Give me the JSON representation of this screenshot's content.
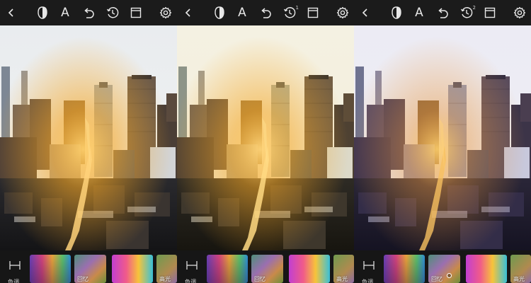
{
  "toolbar": {
    "back_icon": "chevron-left-icon",
    "mask_icon": "half-mask-icon",
    "text_tool_label": "A",
    "undo_icon": "undo-icon",
    "history_icon": "history-icon",
    "crop_icon": "frame-icon",
    "settings_icon": "gear-icon"
  },
  "panels": [
    {
      "variant": "original",
      "history_badge": "",
      "filters": [
        {
          "name": "色调"
        },
        {
          "name": "",
          "selected": false
        },
        {
          "name": "回忆",
          "selected": false
        },
        {
          "name": "",
          "selected": false
        },
        {
          "name": "高光",
          "selected": false
        }
      ]
    },
    {
      "variant": "warm-faded",
      "history_badge": "1",
      "filters": [
        {
          "name": "色调"
        },
        {
          "name": "",
          "selected": false
        },
        {
          "name": "回忆",
          "selected": false
        },
        {
          "name": "",
          "selected": false
        },
        {
          "name": "高光",
          "selected": false
        }
      ]
    },
    {
      "variant": "cool-violet",
      "history_badge": "2",
      "filters": [
        {
          "name": "色调"
        },
        {
          "name": "",
          "selected": false
        },
        {
          "name": "回忆",
          "selected": true
        },
        {
          "name": "",
          "selected": false
        },
        {
          "name": "高光",
          "selected": false
        }
      ]
    }
  ],
  "colors": {
    "bar_bg": "#1b1b1b",
    "bottom_bg": "#161616",
    "icon": "#e8e8e8",
    "sunlight": "#f5a623"
  }
}
